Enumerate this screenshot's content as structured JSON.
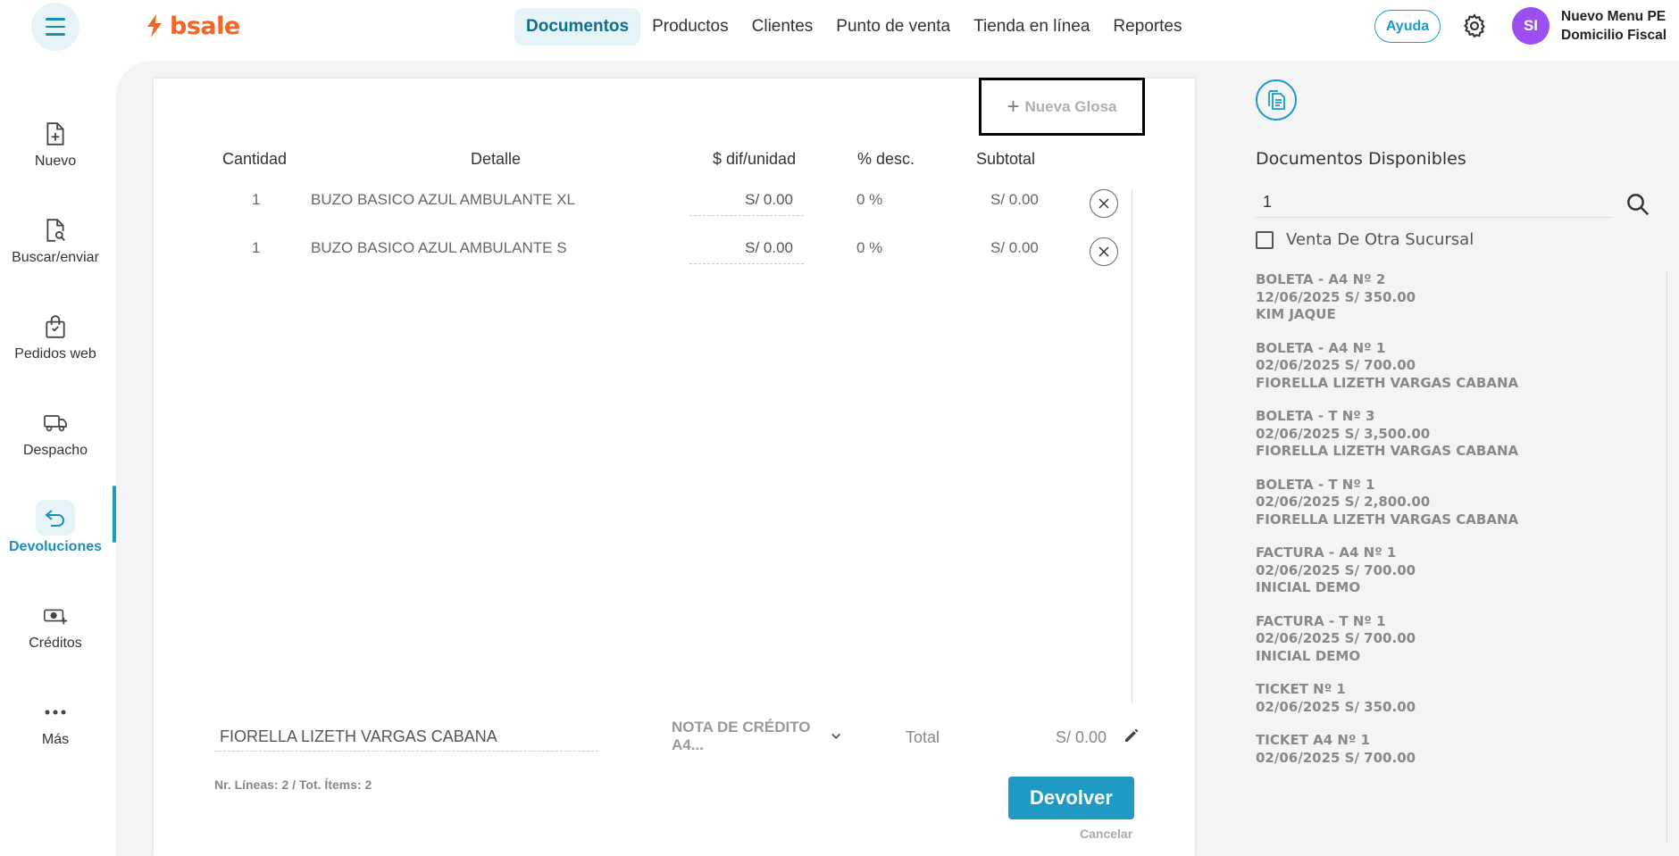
{
  "header": {
    "logo_text": "bsale",
    "nav": [
      {
        "label": "Documentos",
        "active": true
      },
      {
        "label": "Productos",
        "active": false
      },
      {
        "label": "Clientes",
        "active": false
      },
      {
        "label": "Punto de venta",
        "active": false
      },
      {
        "label": "Tienda en línea",
        "active": false
      },
      {
        "label": "Reportes",
        "active": false
      }
    ],
    "help_label": "Ayuda",
    "avatar_initials": "SI",
    "user_line1": "Nuevo Menu PE",
    "user_line2": "Domicilio Fiscal"
  },
  "sidebar": {
    "items": [
      {
        "label": "Nuevo",
        "icon": "file-plus-icon"
      },
      {
        "label": "Buscar/enviar",
        "icon": "file-search-icon"
      },
      {
        "label": "Pedidos web",
        "icon": "shopping-bag-icon"
      },
      {
        "label": "Despacho",
        "icon": "truck-icon"
      },
      {
        "label": "Devoluciones",
        "icon": "return-arrow-icon",
        "active": true
      },
      {
        "label": "Créditos",
        "icon": "cash-plus-icon"
      },
      {
        "label": "Más",
        "icon": "more-dots-icon"
      }
    ]
  },
  "main": {
    "glosa_label": "Nueva Glosa",
    "columns": {
      "cantidad": "Cantidad",
      "detalle": "Detalle",
      "dif_unidad": "$ dif/unidad",
      "desc": "% desc.",
      "subtotal": "Subtotal"
    },
    "rows": [
      {
        "cantidad": "1",
        "detalle": "BUZO BASICO AZUL AMBULANTE XL",
        "dif": "S/ 0.00",
        "desc": "0 %",
        "subtotal": "S/ 0.00"
      },
      {
        "cantidad": "1",
        "detalle": "BUZO BASICO AZUL AMBULANTE S",
        "dif": "S/ 0.00",
        "desc": "0 %",
        "subtotal": "S/ 0.00"
      }
    ],
    "footer": {
      "client": "FIORELLA LIZETH VARGAS CABANA",
      "doc_type": "NOTA DE CRÉDITO A4...",
      "total_label": "Total",
      "total_value": "S/ 0.00",
      "lines_info": "Nr. Líneas: 2 / Tot. Ítems: 2",
      "devolver_label": "Devolver",
      "cancel_label": "Cancelar"
    }
  },
  "right_panel": {
    "title": "Documentos Disponibles",
    "search_value": "1",
    "checkbox_label": "Venta De Otra Sucursal",
    "docs": [
      {
        "line1": "BOLETA - A4 Nº 2",
        "line2": "12/06/2025 S/ 350.00",
        "line3": "KIM JAQUE"
      },
      {
        "line1": "BOLETA - A4 Nº 1",
        "line2": "02/06/2025 S/ 700.00",
        "line3": "FIORELLA LIZETH VARGAS CABANA"
      },
      {
        "line1": "BOLETA - T Nº 3",
        "line2": "02/06/2025 S/ 3,500.00",
        "line3": "FIORELLA LIZETH VARGAS CABANA"
      },
      {
        "line1": "BOLETA - T Nº 1",
        "line2": "02/06/2025 S/ 2,800.00",
        "line3": "FIORELLA LIZETH VARGAS CABANA"
      },
      {
        "line1": "FACTURA - A4 Nº 1",
        "line2": "02/06/2025 S/ 700.00",
        "line3": "INICIAL DEMO"
      },
      {
        "line1": "FACTURA - T Nº 1",
        "line2": "02/06/2025 S/ 700.00",
        "line3": "INICIAL DEMO"
      },
      {
        "line1": "TICKET Nº 1",
        "line2": "02/06/2025 S/ 350.00",
        "line3": ""
      },
      {
        "line1": "TICKET A4 Nº 1",
        "line2": "02/06/2025 S/ 700.00",
        "line3": ""
      }
    ]
  },
  "colors": {
    "brand_orange": "#f26522",
    "accent_blue": "#1f9ac4",
    "avatar_purple": "#9b4ff0"
  }
}
